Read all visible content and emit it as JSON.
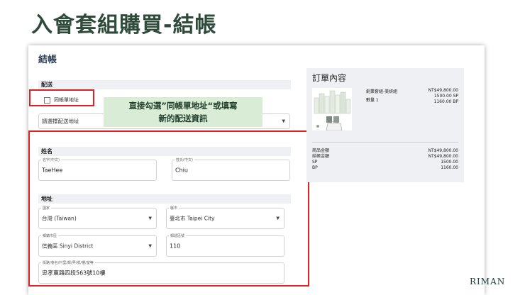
{
  "slide_title": "入會套組購買-結帳",
  "page_heading": "結帳",
  "shipping": {
    "section_label": "配送",
    "same_as_billing_label": "同帳單地址",
    "address_select_placeholder": "請選擇配送地址"
  },
  "callout_lines": [
    "直接勾選”同帳單地址“或填寫",
    "新的配送資訊"
  ],
  "name_section": {
    "label": "姓名",
    "first_name": {
      "label": "名字(中文)",
      "value": "TaeHee"
    },
    "last_name": {
      "label": "姓氏(中文)",
      "value": "Chiu"
    }
  },
  "address_section": {
    "label": "地址",
    "country": {
      "label": "國家",
      "value": "台灣 (Taiwan)"
    },
    "city": {
      "label": "縣市",
      "value": "臺北市 Taipei City"
    },
    "district": {
      "label": "鄉鎮市區",
      "value": "信義區 Sinyi District"
    },
    "postal": {
      "label": "郵遞區號",
      "value": "110"
    },
    "street": {
      "label": "街路/巷名/村里/鄰/弄/號/樓/室等",
      "value": "忠孝東路四段563號10樓"
    }
  },
  "order_summary": {
    "title": "訂單內容",
    "product_name": "創業套組-美妍組",
    "quantity": "數量 1",
    "price": "NT$49,800.00",
    "sp": "1500.00 SP",
    "bp": "1160.00 BP",
    "totals_labels": [
      "商品金額",
      "結帳金額",
      "SP",
      "BP"
    ],
    "totals_values": [
      "NT$49,800.00",
      "NT$49,800.00",
      "1500.00",
      "1160.00"
    ]
  },
  "brand": "RIMAN",
  "colors": {
    "accent_red": "#e02020",
    "title_green": "#2e4a3a",
    "callout_bg": "#d9ecd6"
  }
}
